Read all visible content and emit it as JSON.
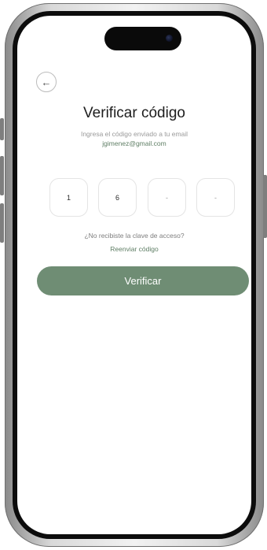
{
  "screen": {
    "back_icon": "←",
    "title": "Verificar código",
    "subtitle": "Ingresa el código enviado a tu email",
    "email": "jgimenez@gmail.com",
    "code_digits": [
      "1",
      "6",
      "-",
      "-"
    ],
    "question": "¿No recibiste la clave de acceso?",
    "resend_label": "Reenviar código",
    "verify_label": "Verificar"
  },
  "colors": {
    "accent_green": "#6f8d74",
    "link_green": "#5f7e65",
    "title_text": "#1d1d1d",
    "muted_text": "#9a9a9a"
  },
  "icons": {
    "back": "arrow-left-icon"
  }
}
